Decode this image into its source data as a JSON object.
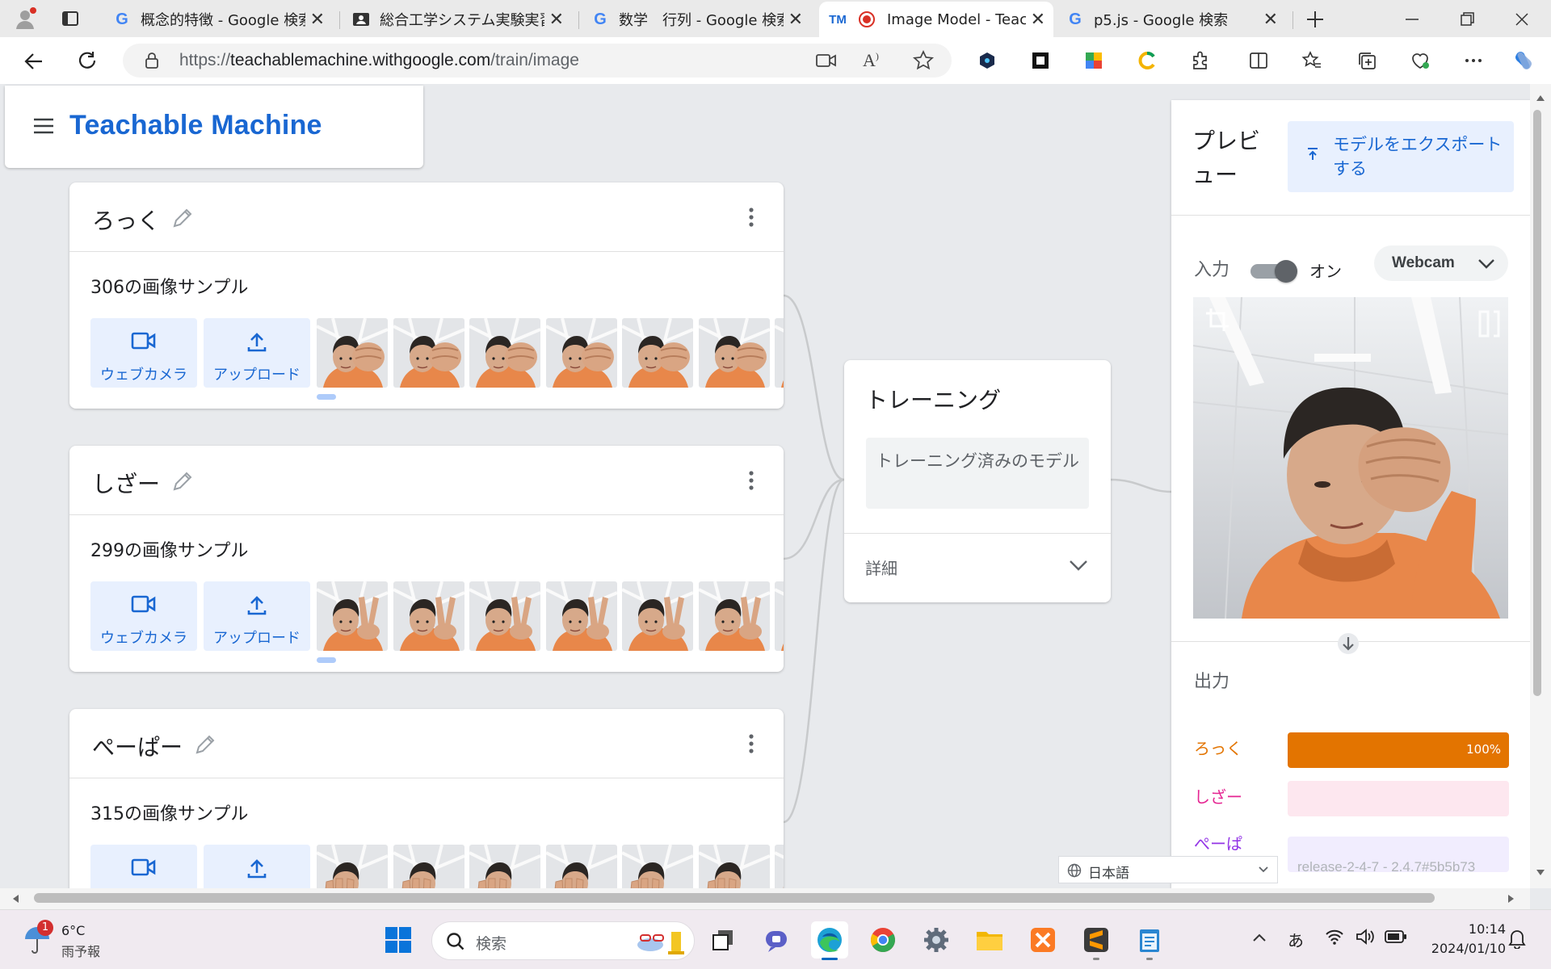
{
  "browser": {
    "tabs": [
      {
        "title": "概念的特徴 - Google 検索",
        "favicon": "google-g-icon"
      },
      {
        "title": "総合工学システム実験実習",
        "favicon": "contact-card-icon"
      },
      {
        "title": "数学　行列 - Google 検索",
        "favicon": "google-g-icon"
      },
      {
        "title": "Image Model - Teachable Machine",
        "favicon": "tm-logo-icon",
        "active": true
      },
      {
        "title": "p5.js - Google 検索",
        "favicon": "google-g-icon"
      }
    ],
    "tm_logo_text": "TM",
    "url_scheme": "https://",
    "url_host": "teachablemachine.withgoogle.com",
    "url_path": "/train/image"
  },
  "app": {
    "title": "Teachable Machine",
    "classes": [
      {
        "name": "ろっく",
        "count": "306の画像サンプル",
        "webcam_label": "ウェブカメラ",
        "upload_label": "アップロード",
        "gesture": "fist"
      },
      {
        "name": "しざー",
        "count": "299の画像サンプル",
        "webcam_label": "ウェブカメラ",
        "upload_label": "アップロード",
        "gesture": "peace"
      },
      {
        "name": "ぺーぱー",
        "count": "315の画像サンプル",
        "webcam_label": "ウェブカメラ",
        "upload_label": "アップロード",
        "gesture": "open"
      }
    ],
    "training": {
      "title": "トレーニング",
      "button": "トレーニング済みのモデル",
      "advanced": "詳細"
    },
    "preview": {
      "title": "プレビュー",
      "export": "モデルをエクスポートする",
      "input_label": "入力",
      "toggle_label": "オン",
      "toggle_on": true,
      "source": "Webcam",
      "output_label": "出力",
      "outputs": [
        {
          "label": "ろっく",
          "value": 100,
          "value_text": "100%",
          "color": "#e37400",
          "bg": "#e37400"
        },
        {
          "label": "しざー",
          "value": 0,
          "value_text": "",
          "color": "#e52592",
          "bg": "#fde7ef"
        },
        {
          "label": "ぺーぱー",
          "value": 0,
          "value_text": "",
          "color": "#9334e6",
          "bg": "#f1edfe"
        }
      ]
    },
    "language": "日本語",
    "release": "release-2-4-7 - 2.4.7#5b5b73"
  },
  "taskbar": {
    "weather_badge": "1",
    "temperature": "6°C",
    "forecast": "雨予報",
    "search_placeholder": "検索",
    "time": "10:14",
    "date": "2024/01/10",
    "ime": "あ"
  }
}
